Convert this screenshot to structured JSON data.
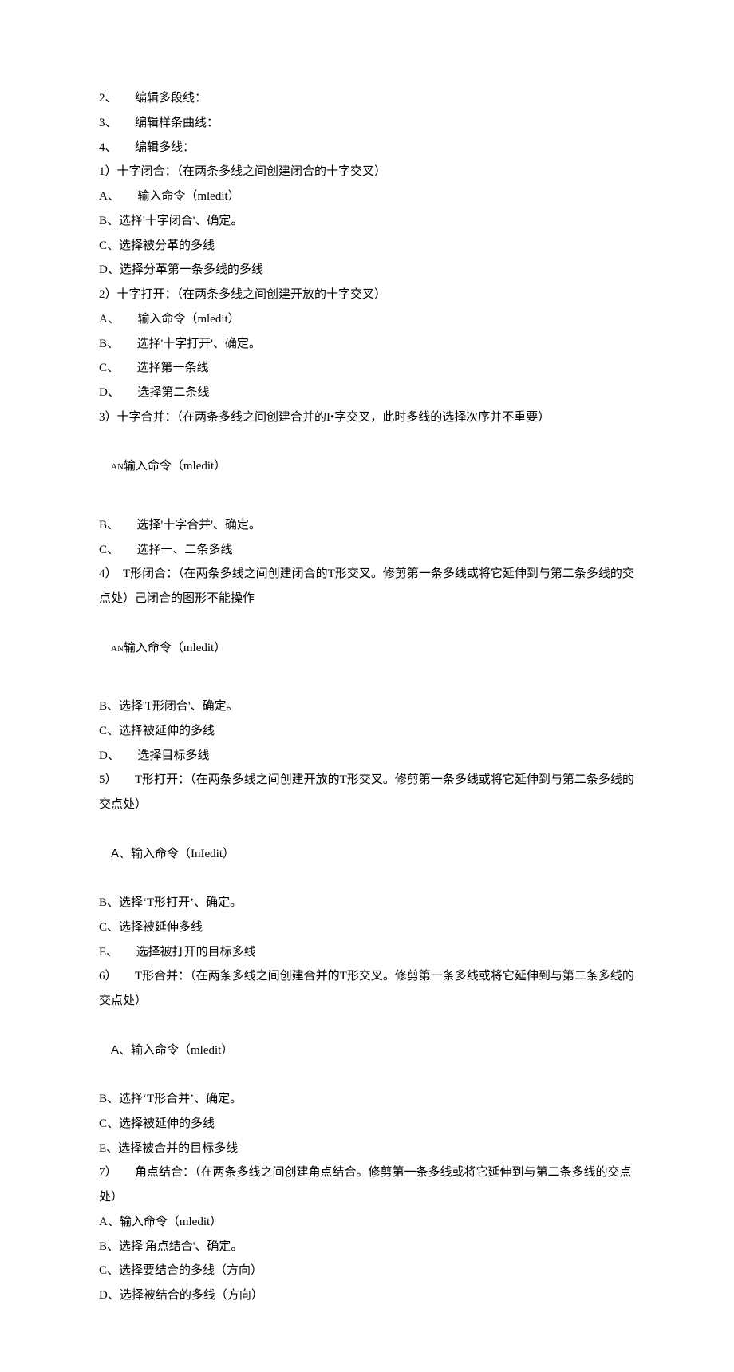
{
  "lines": [
    "2、　　编辑多段线：",
    "3、　　编辑样条曲线：",
    "4、　　编辑多线：",
    "1）十字闭合：（在两条多线之间创建闭合的十字交叉）",
    "A、　　输入命令（mledit）",
    "B、选择'十字闭合'、确定。",
    "C、选择被分革的多线",
    "D、选择分革第一条多线的多线",
    "2）十字打开：（在两条多线之间创建开放的十字交叉）",
    "A、　　输入命令（mledit）",
    "B、　　选择'十字打开'、确定。",
    "C、　　选择第一条线",
    "D、　　选择第二条线",
    "3）十字合并：（在两条多线之间创建合并的I•字交叉，此时多线的选择次序并不重要）"
  ],
  "an1_prefix": "AN",
  "an1_text": "输入命令（mledit）",
  "lines2": [
    "B、　　选择'十字合并'、确定。",
    "C、　　选择一、二条多线",
    "4）　T形闭合：（在两条多线之间创建闭合的T形交叉。修剪第一条多线或将它延伸到与第二条多线的交点处）己闭合的图形不能操作"
  ],
  "an2_prefix": "AN",
  "an2_text": "输入命令（mledit）",
  "lines3": [
    "B、选择'T形闭合'、确定。",
    "C、选择被延伸的多线",
    "D、　　选择目标多线",
    "5）　　T形打开：（在两条多线之间创建开放的T形交叉。修剪第一条多线或将它延伸到与第二条多线的交点处）"
  ],
  "a5_prefix": "A",
  "a5_text": "、输入命令（InIedit）",
  "lines4": [
    "B、选择‘T形打开’、确定。",
    "C、选择被延伸多线",
    "E、　　选择被打开的目标多线",
    "6）　　T形合并：（在两条多线之间创建合并的T形交叉。修剪第一条多线或将它延伸到与第二条多线的交点处）"
  ],
  "a6_prefix": "A",
  "a6_text": "、输入命令（mledit）",
  "lines5": [
    "B、选择‘T形合并’、确定。",
    "C、选择被延伸的多线",
    "E、选择被合并的目标多线",
    "7）　　角点结合：（在两条多线之间创建角点结合。修剪第一条多线或将它延伸到与第二条多线的交点处）",
    "A、输入命令（mledit）",
    "B、选择'角点结合'、确定。",
    "C、选择要结合的多线（方向）",
    "D、选择被结合的多线（方向）"
  ]
}
